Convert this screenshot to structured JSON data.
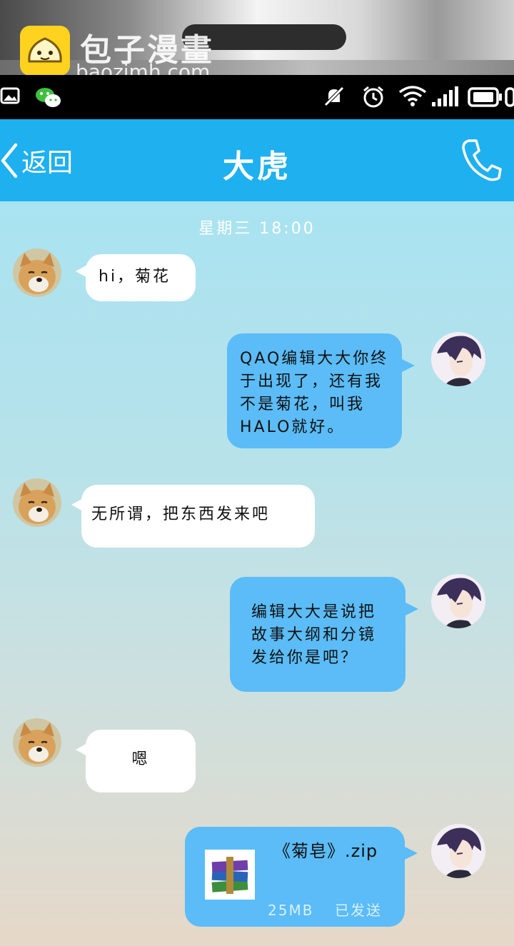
{
  "watermark": {
    "title": "包子漫畫",
    "url": "baozimh.com"
  },
  "status_bar": {
    "icons": [
      "gallery-icon",
      "wechat-icon",
      "mute-icon",
      "alarm-icon",
      "wifi-icon",
      "signal-icon",
      "battery-icon"
    ]
  },
  "header": {
    "back_label": "返回",
    "title": "大虎",
    "call_icon": "phone-icon"
  },
  "chat": {
    "timestamp": "星期三  18:00",
    "messages": [
      {
        "side": "left",
        "text": "hi，菊花"
      },
      {
        "side": "right",
        "lines": [
          "QAQ编辑大大你终",
          "于出现了，还有我",
          "不是菊花，叫我",
          "HALO就好。"
        ]
      },
      {
        "side": "left",
        "text": "无所谓，把东西发来吧"
      },
      {
        "side": "right",
        "lines": [
          "编辑大大是说把",
          "故事大纲和分镜",
          "发给你是吧？"
        ]
      },
      {
        "side": "left",
        "text": "嗯"
      },
      {
        "side": "right",
        "file": {
          "name": "《菊皂》.zip",
          "size": "25MB",
          "status": "已发送"
        }
      }
    ]
  },
  "colors": {
    "header": "#1eb0ef",
    "bubble_right": "#5bbcf7",
    "bubble_left": "#ffffff"
  }
}
